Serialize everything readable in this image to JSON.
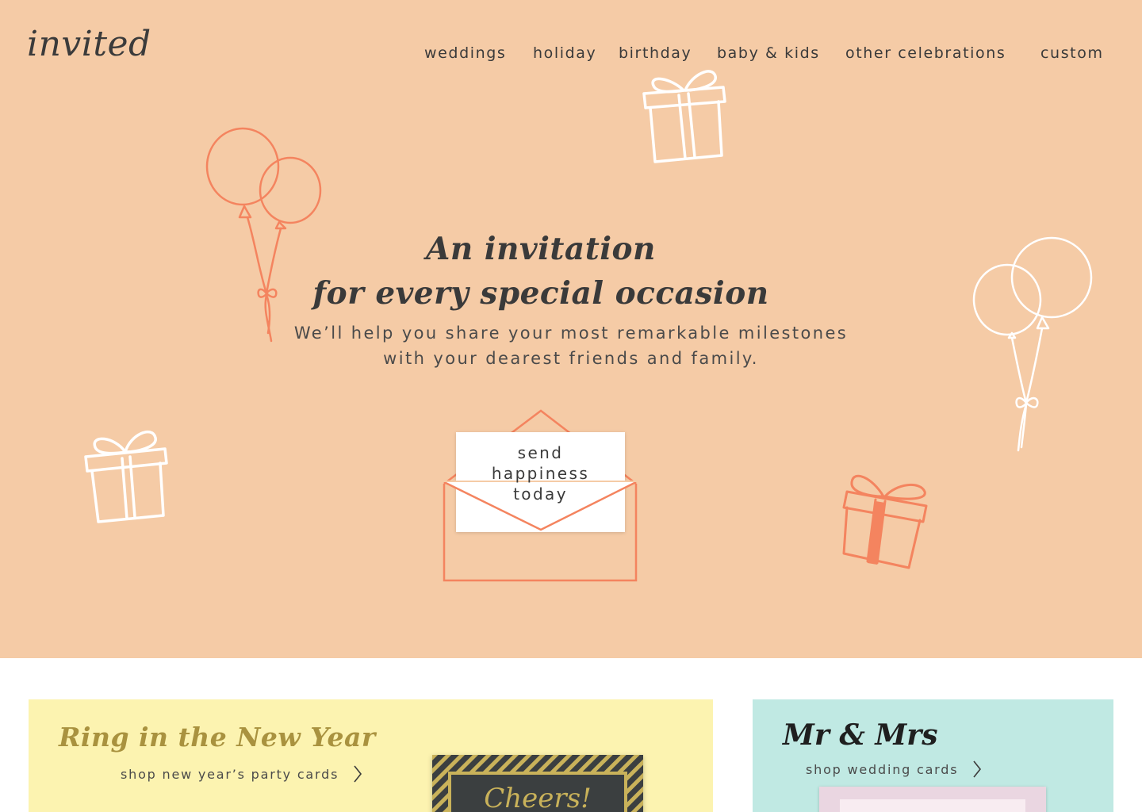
{
  "brand": {
    "logo": "invited"
  },
  "nav": {
    "items": [
      "weddings",
      "holiday",
      "birthday",
      "baby & kids",
      "other celebrations",
      "custom"
    ]
  },
  "hero": {
    "title_line1": "An invitation",
    "title_line2": "for every special occasion",
    "subtitle_line1": "We’ll help you share your most remarkable milestones",
    "subtitle_line2": "with your dearest friends and family.",
    "cta": {
      "line1": "send",
      "line2": "happiness",
      "line3": "today"
    },
    "decorations": [
      "balloons-icon",
      "gift-icon"
    ]
  },
  "cards": {
    "new_year": {
      "title": "Ring in the New Year",
      "link": "shop new year’s party cards",
      "preview_text": "Cheers!"
    },
    "wedding": {
      "title": "Mr & Mrs",
      "link": "shop wedding cards"
    }
  },
  "colors": {
    "hero_bg": "#f5cba6",
    "accent_coral": "#f4845f",
    "new_year_bg": "#fcf3b0",
    "new_year_gold": "#a9923f",
    "wedding_bg": "#c0e9e3",
    "text_dark": "#3a3a3a"
  }
}
